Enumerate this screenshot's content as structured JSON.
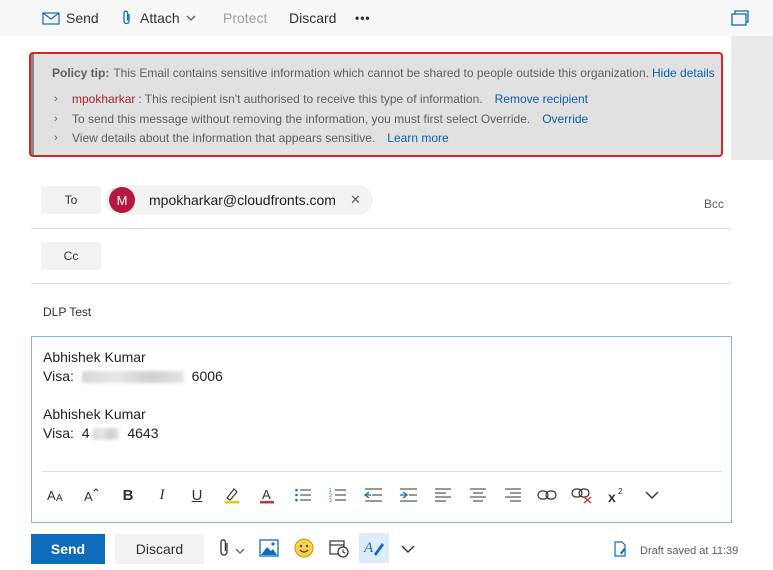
{
  "toolbar": {
    "send_label": "Send",
    "attach_label": "Attach",
    "protect_label": "Protect",
    "discard_label": "Discard",
    "more_label": "•••"
  },
  "policy_tip": {
    "prefix": "Policy tip:",
    "message": "This Email contains sensitive information which cannot be shared to people outside this organization.",
    "hide_link": "Hide details",
    "rows": [
      {
        "name": "mpokharkar",
        "text": ": This recipient isn't authorised to receive this type of information.",
        "link": "Remove recipient"
      },
      {
        "name": "",
        "text": "To send this message without removing the information, you must first select Override.",
        "link": "Override"
      },
      {
        "name": "",
        "text": "View details about the information that appears sensitive.",
        "link": "Learn more"
      }
    ],
    "chevron": "›"
  },
  "to_label": "To",
  "cc_label": "Cc",
  "bcc_label": "Bcc",
  "recipient": {
    "initial": "M",
    "email": "mpokharkar@cloudfronts.com",
    "remove": "✕"
  },
  "subject": "DLP Test",
  "body": {
    "name1": "Abhishek Kumar",
    "visa_label1": "Visa:",
    "visa_end1": "6006",
    "name2": "Abhishek Kumar",
    "visa_label2": "Visa:",
    "visa_start2": "4",
    "visa_end2": "4643"
  },
  "format_icons": [
    "font-size-icon",
    "font-grow-icon",
    "bold-icon",
    "italic-icon",
    "underline-icon",
    "highlight-icon",
    "font-color-icon",
    "bullets-icon",
    "numbering-icon",
    "decrease-indent-icon",
    "increase-indent-icon",
    "align-left-icon",
    "align-center-icon",
    "align-right-icon",
    "link-icon",
    "remove-link-icon",
    "superscript-icon",
    "more-format-icon"
  ],
  "bottom": {
    "send_label": "Send",
    "discard_label": "Discard",
    "draft_status": "Draft saved at 11:39"
  },
  "colors": {
    "accent": "#0f6cbd",
    "warning_outline": "#d8232a",
    "avatar": "#b4183f"
  }
}
